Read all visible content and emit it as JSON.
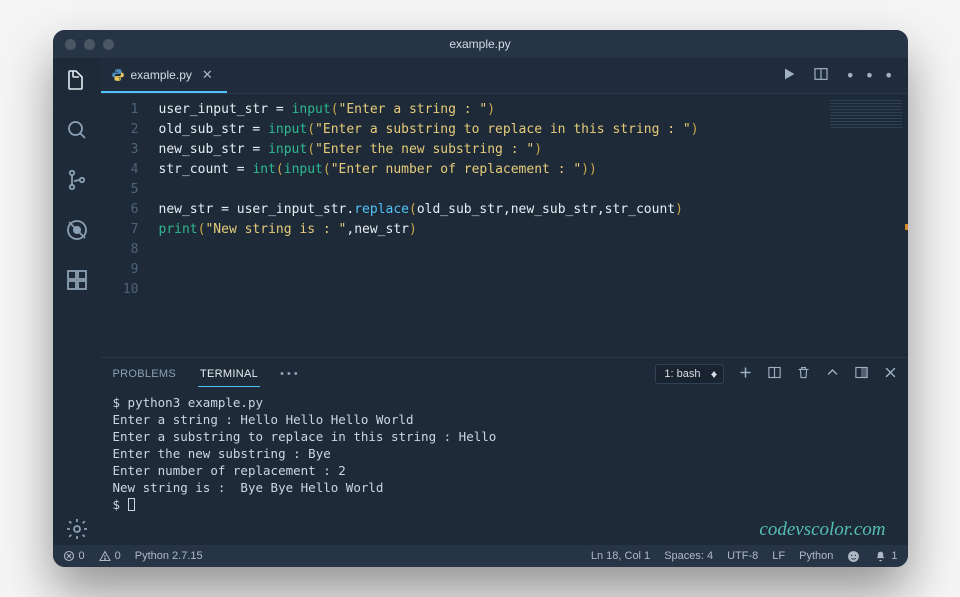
{
  "window": {
    "title": "example.py"
  },
  "tabs": [
    {
      "label": "example.py"
    }
  ],
  "code": {
    "lines": [
      [
        {
          "cls": "tok-var",
          "t": "user_input_str "
        },
        {
          "cls": "tok-op",
          "t": "= "
        },
        {
          "cls": "tok-builtin",
          "t": "input"
        },
        {
          "cls": "tok-punc",
          "t": "("
        },
        {
          "cls": "tok-str",
          "t": "\"Enter a string : \""
        },
        {
          "cls": "tok-punc",
          "t": ")"
        }
      ],
      [
        {
          "cls": "tok-var",
          "t": "old_sub_str "
        },
        {
          "cls": "tok-op",
          "t": "= "
        },
        {
          "cls": "tok-builtin",
          "t": "input"
        },
        {
          "cls": "tok-punc",
          "t": "("
        },
        {
          "cls": "tok-str",
          "t": "\"Enter a substring to replace in this string : \""
        },
        {
          "cls": "tok-punc",
          "t": ")"
        }
      ],
      [
        {
          "cls": "tok-var",
          "t": "new_sub_str "
        },
        {
          "cls": "tok-op",
          "t": "= "
        },
        {
          "cls": "tok-builtin",
          "t": "input"
        },
        {
          "cls": "tok-punc",
          "t": "("
        },
        {
          "cls": "tok-str",
          "t": "\"Enter the new substring : \""
        },
        {
          "cls": "tok-punc",
          "t": ")"
        }
      ],
      [
        {
          "cls": "tok-var",
          "t": "str_count "
        },
        {
          "cls": "tok-op",
          "t": "= "
        },
        {
          "cls": "tok-builtin",
          "t": "int"
        },
        {
          "cls": "tok-punc",
          "t": "("
        },
        {
          "cls": "tok-builtin",
          "t": "input"
        },
        {
          "cls": "tok-punc",
          "t": "("
        },
        {
          "cls": "tok-str",
          "t": "\"Enter number of replacement : \""
        },
        {
          "cls": "tok-punc",
          "t": "))"
        }
      ],
      [],
      [
        {
          "cls": "tok-var",
          "t": "new_str "
        },
        {
          "cls": "tok-op",
          "t": "= "
        },
        {
          "cls": "tok-var",
          "t": "user_input_str"
        },
        {
          "cls": "tok-op",
          "t": "."
        },
        {
          "cls": "tok-method",
          "t": "replace"
        },
        {
          "cls": "tok-punc",
          "t": "("
        },
        {
          "cls": "tok-var",
          "t": "old_sub_str"
        },
        {
          "cls": "tok-op",
          "t": ","
        },
        {
          "cls": "tok-var",
          "t": "new_sub_str"
        },
        {
          "cls": "tok-op",
          "t": ","
        },
        {
          "cls": "tok-var",
          "t": "str_count"
        },
        {
          "cls": "tok-punc",
          "t": ")"
        }
      ],
      [
        {
          "cls": "tok-builtin",
          "t": "print"
        },
        {
          "cls": "tok-punc",
          "t": "("
        },
        {
          "cls": "tok-str",
          "t": "\"New string is : \""
        },
        {
          "cls": "tok-op",
          "t": ","
        },
        {
          "cls": "tok-var",
          "t": "new_str"
        },
        {
          "cls": "tok-punc",
          "t": ")"
        }
      ],
      [],
      [],
      []
    ],
    "line_numbers": [
      "1",
      "2",
      "3",
      "4",
      "5",
      "6",
      "7",
      "8",
      "9",
      "10"
    ]
  },
  "panel": {
    "tabs": {
      "problems": "PROBLEMS",
      "terminal": "TERMINAL"
    },
    "terminal_select": "1: bash",
    "terminal_lines": [
      "$ python3 example.py",
      "Enter a string : Hello Hello Hello World",
      "Enter a substring to replace in this string : Hello",
      "Enter the new substring : Bye",
      "Enter number of replacement : 2",
      "New string is :  Bye Bye Hello World",
      "$ "
    ]
  },
  "status": {
    "errors": "0",
    "warnings": "0",
    "interpreter": "Python 2.7.15",
    "pos": "Ln 18, Col 1",
    "spaces": "Spaces: 4",
    "encoding": "UTF-8",
    "eol": "LF",
    "language": "Python",
    "bell": "1"
  },
  "watermark": "codevscolor.com"
}
